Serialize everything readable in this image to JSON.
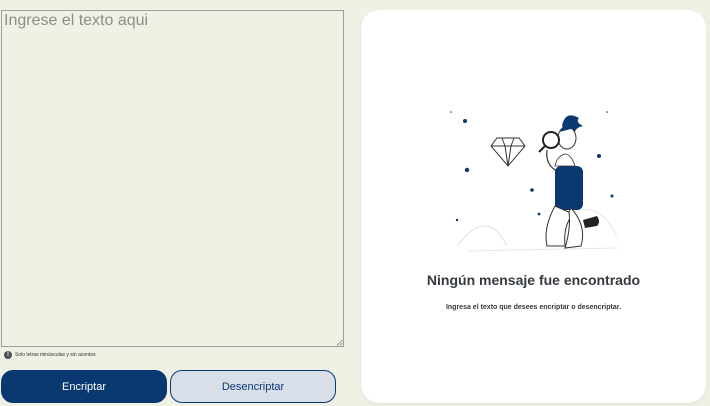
{
  "input": {
    "placeholder": "Ingrese el texto aqui",
    "value": ""
  },
  "hint": {
    "icon": "info-icon",
    "text": "Solo letras minúsculas y sin acentos"
  },
  "buttons": {
    "encrypt_label": "Encriptar",
    "decrypt_label": "Desencriptar"
  },
  "output": {
    "title": "Ningún mensaje fue encontrado",
    "subtitle": "Ingresa el texto que desees encriptar o desencriptar."
  },
  "colors": {
    "accent": "#0a3871",
    "background": "#eef1e4",
    "secondary_button": "#d8dfe8"
  }
}
